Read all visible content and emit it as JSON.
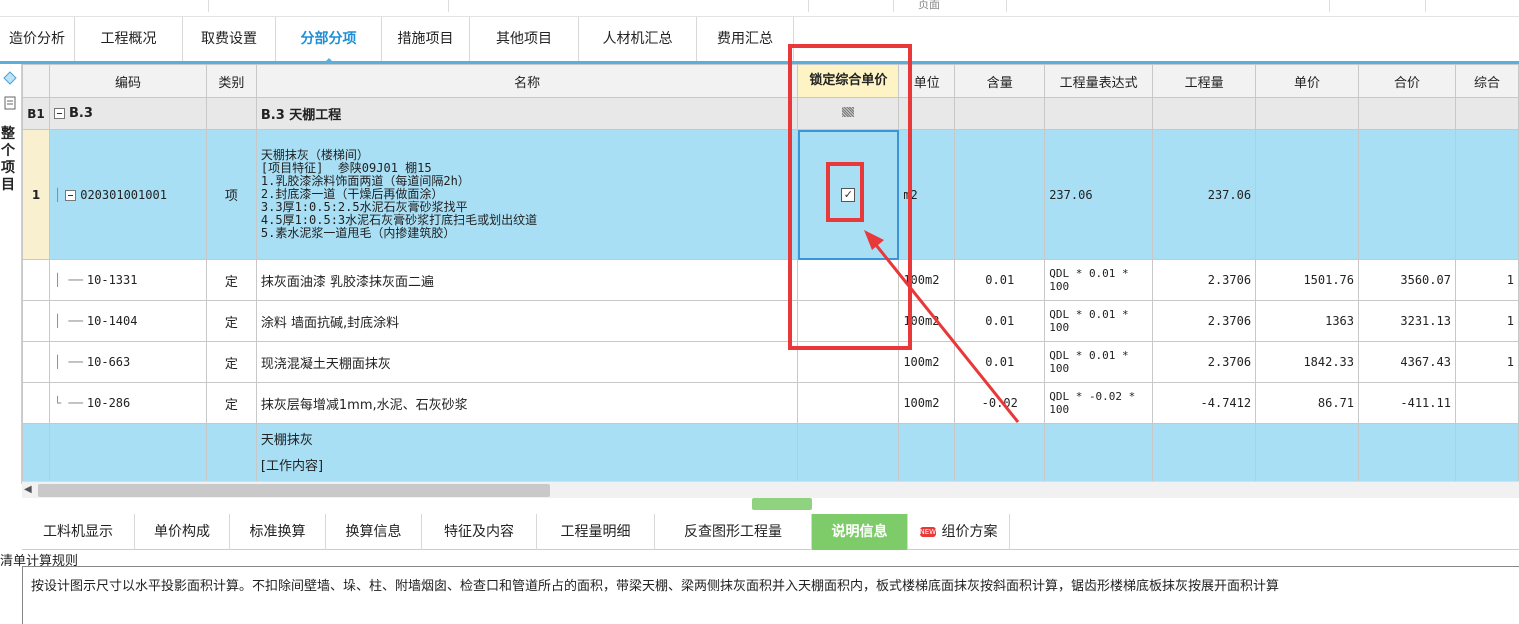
{
  "top_strip": {
    "partial_text": "页面"
  },
  "tabs": [
    {
      "label": "造价分析",
      "active": false
    },
    {
      "label": "工程概况",
      "active": false
    },
    {
      "label": "取费设置",
      "active": false
    },
    {
      "label": "分部分项",
      "active": true
    },
    {
      "label": "措施项目",
      "active": false
    },
    {
      "label": "其他项目",
      "active": false
    },
    {
      "label": "人材机汇总",
      "active": false
    },
    {
      "label": "费用汇总",
      "active": false
    }
  ],
  "left_bar": {
    "vertical_label": "整个项目"
  },
  "grid": {
    "headers": {
      "code": "编码",
      "type": "类别",
      "name": "名称",
      "lock": "锁定综合单价",
      "unit": "单位",
      "qty_content": "含量",
      "expr": "工程量表达式",
      "quantity": "工程量",
      "unit_price": "单价",
      "total_price": "合价",
      "composite": "综合"
    },
    "group_row": {
      "num": "B1",
      "code": "B.3",
      "name": "B.3  天棚工程"
    },
    "item_row": {
      "num": "1",
      "code": "020301001001",
      "type": "项",
      "name_lines": [
        "天棚抹灰（楼梯间）",
        "[项目特征]  参陕09J01 棚15",
        "1.乳胶漆涂料饰面两道（每道间隔2h）",
        "2.封底漆一道（干燥后再做面涂）",
        "3.3厚1:0.5:2.5水泥石灰膏砂浆找平",
        "4.5厚1:0.5:3水泥石灰膏砂浆打底扫毛或划出纹道",
        "5.素水泥浆一道甩毛（内掺建筑胶）"
      ],
      "lock_checked": true,
      "lock_symbol": "✓",
      "unit": "m2",
      "expr": "237.06",
      "quantity": "237.06"
    },
    "sub_rows": [
      {
        "code": "10-1331",
        "type": "定",
        "name": "抹灰面油漆 乳胶漆抹灰面二遍",
        "unit": "100m2",
        "content": "0.01",
        "expr_l1": "QDL * 0.01 *",
        "expr_l2": "100",
        "quantity": "2.3706",
        "unit_price": "1501.76",
        "total": "3560.07",
        "comp": "1"
      },
      {
        "code": "10-1404",
        "type": "定",
        "name": "涂料 墙面抗碱,封底涂料",
        "unit": "100m2",
        "content": "0.01",
        "expr_l1": "QDL * 0.01 *",
        "expr_l2": "100",
        "quantity": "2.3706",
        "unit_price": "1363",
        "total": "3231.13",
        "comp": "1"
      },
      {
        "code": "10-663",
        "type": "定",
        "name": "现浇混凝土天棚面抹灰",
        "unit": "100m2",
        "content": "0.01",
        "expr_l1": "QDL * 0.01 *",
        "expr_l2": "100",
        "quantity": "2.3706",
        "unit_price": "1842.33",
        "total": "4367.43",
        "comp": "1"
      },
      {
        "code": "10-286",
        "type": "定",
        "name": "抹灰层每增减1mm,水泥、石灰砂浆",
        "unit": "100m2",
        "content": "-0.02",
        "expr_l1": "QDL * -0.02 *",
        "expr_l2": "100",
        "quantity": "-4.7412",
        "unit_price": "86.71",
        "total": "-411.11",
        "comp": ""
      }
    ],
    "next_row": {
      "name_l1": "天棚抹灰",
      "name_l2": "[工作内容]"
    }
  },
  "bottom_tabs": [
    {
      "label": "工料机显示",
      "active": false
    },
    {
      "label": "单价构成",
      "active": false
    },
    {
      "label": "标准换算",
      "active": false
    },
    {
      "label": "换算信息",
      "active": false
    },
    {
      "label": "特征及内容",
      "active": false
    },
    {
      "label": "工程量明细",
      "active": false
    },
    {
      "label": "反查图形工程量",
      "active": false
    },
    {
      "label": "说明信息",
      "active": true
    },
    {
      "label": "组价方案",
      "active": false,
      "badge": "NEW"
    }
  ],
  "description": {
    "title": "清单计算规则",
    "text": "按设计图示尺寸以水平投影面积计算。不扣除间壁墙、垛、柱、附墙烟囱、检查口和管道所占的面积，带梁天棚、梁两侧抹灰面积并入天棚面积内，板式楼梯底面抹灰按斜面积计算，锯齿形楼梯底板抹灰按展开面积计算"
  },
  "colors": {
    "accent": "#1e8ed6",
    "selected_row": "#a8dff5",
    "active_bottom_tab": "#7ecb6a",
    "highlight": "#e8383a"
  }
}
